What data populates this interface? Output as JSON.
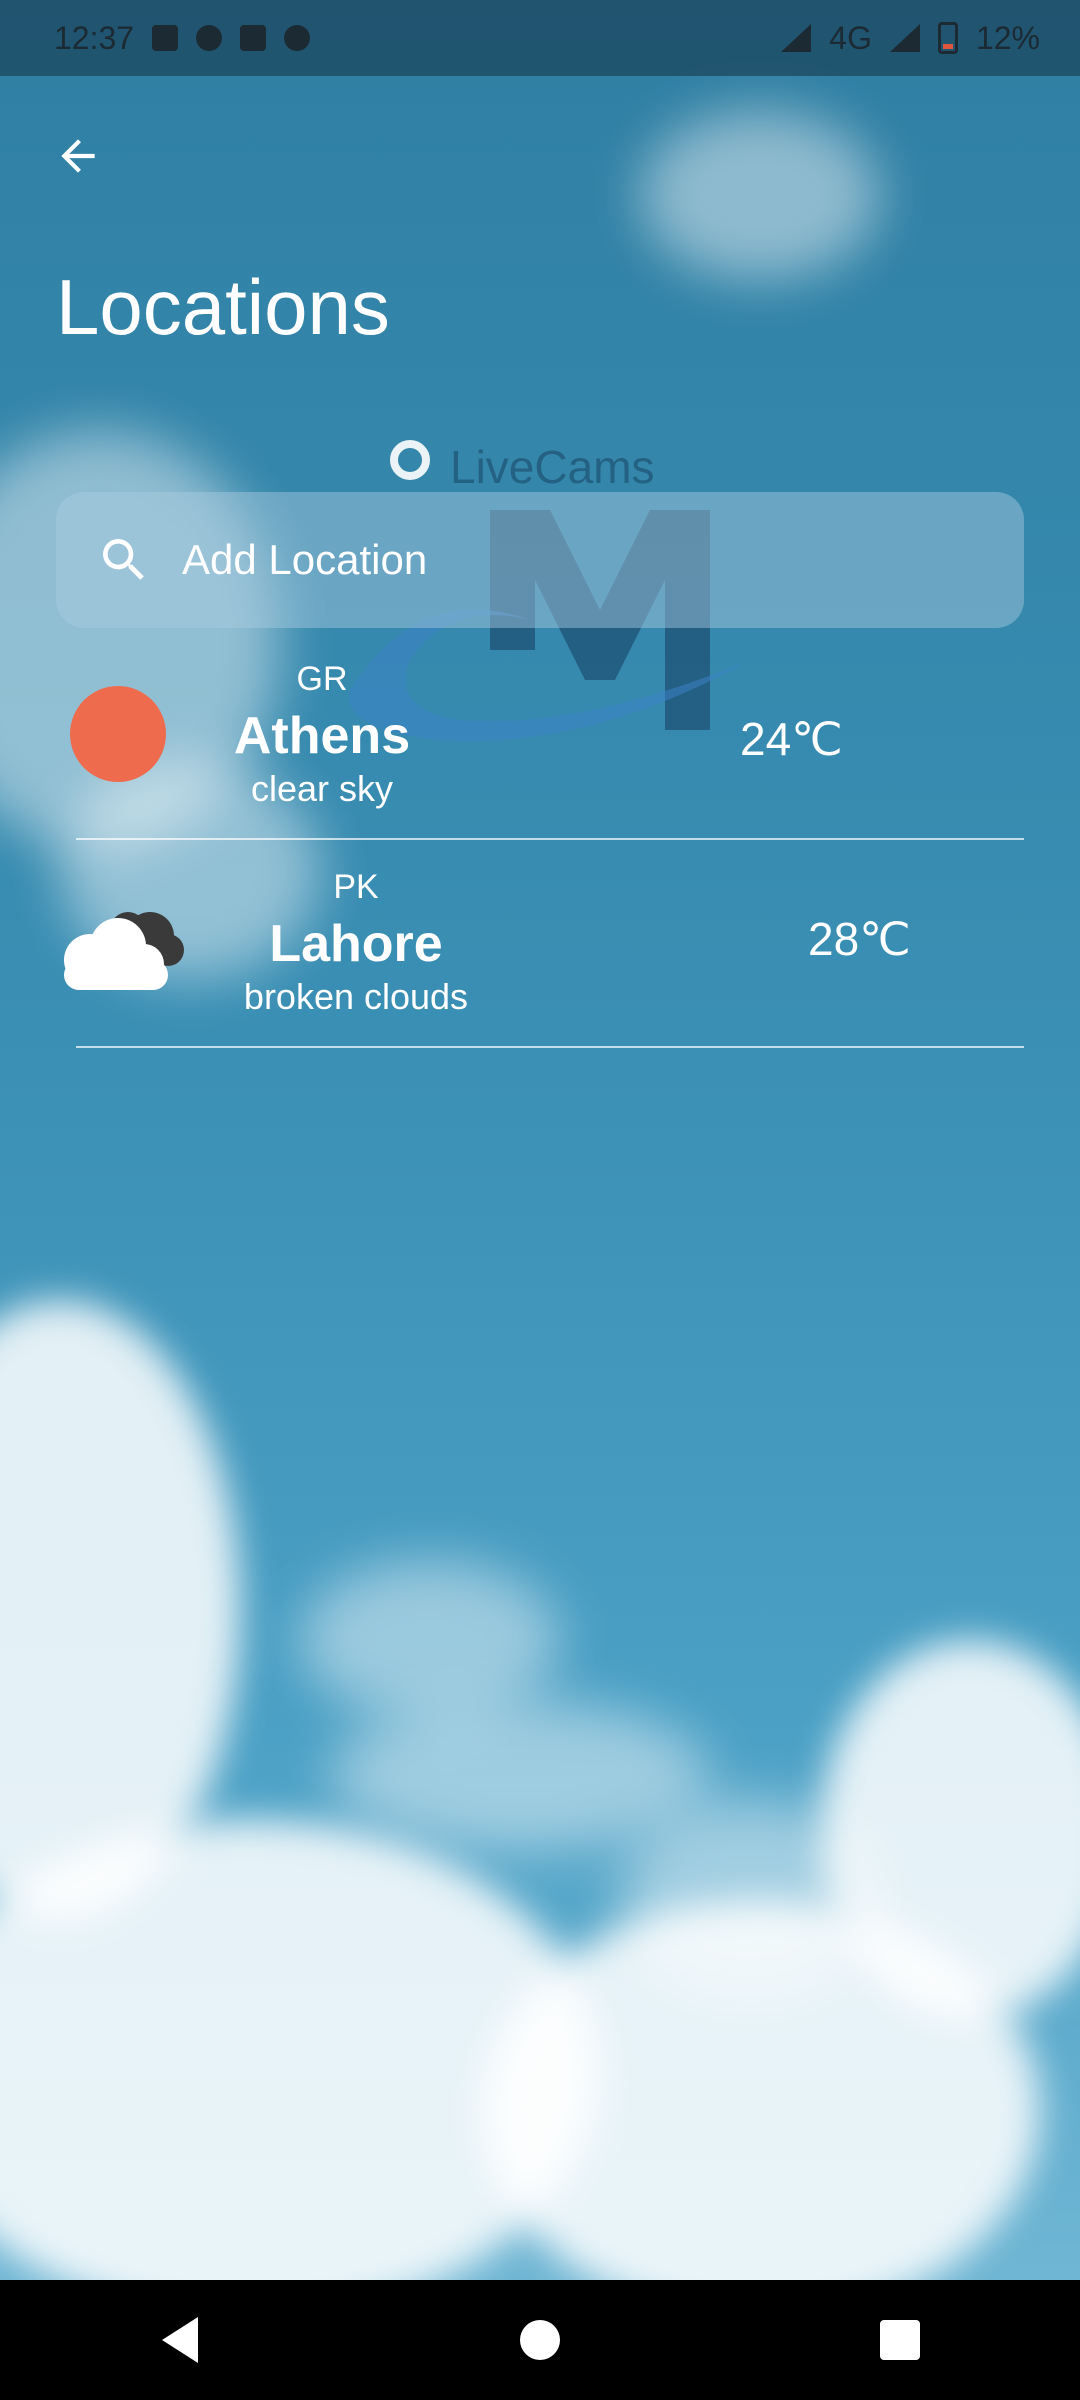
{
  "status_bar": {
    "time": "12:37",
    "network": "4G",
    "battery": "12%"
  },
  "header": {
    "back_icon": "arrow-left-icon",
    "title": "Locations"
  },
  "watermark": {
    "text": "LiveCams"
  },
  "search": {
    "placeholder": "Add Location",
    "icon": "search-icon"
  },
  "locations": [
    {
      "country": "GR",
      "city": "Athens",
      "description": "clear sky",
      "temperature": "24℃",
      "icon": "sun-icon",
      "icon_color": "#ee6c4d"
    },
    {
      "country": "PK",
      "city": "Lahore",
      "description": "broken clouds",
      "temperature": "28℃",
      "icon": "broken-clouds-icon"
    }
  ],
  "nav_bar": {
    "back_icon": "nav-back-icon",
    "home_icon": "nav-home-icon",
    "recents_icon": "nav-recents-icon"
  }
}
